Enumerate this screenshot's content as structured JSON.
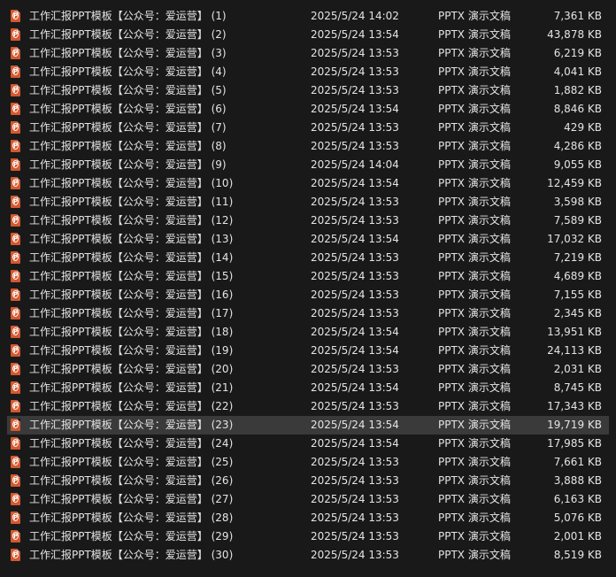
{
  "colors": {
    "background": "#191919",
    "selected_row": "#3a3a3a",
    "text": "#e4e4e4",
    "icon": "#d4582f"
  },
  "icon_name": "pptx-file-icon",
  "selected_index": 22,
  "files": [
    {
      "name": "工作汇报PPT模板【公众号：爱运营】 (1)",
      "date": "2025/5/24 14:02",
      "type": "PPTX 演示文稿",
      "size": "7,361 KB"
    },
    {
      "name": "工作汇报PPT模板【公众号：爱运营】 (2)",
      "date": "2025/5/24 13:54",
      "type": "PPTX 演示文稿",
      "size": "43,878 KB"
    },
    {
      "name": "工作汇报PPT模板【公众号：爱运营】 (3)",
      "date": "2025/5/24 13:53",
      "type": "PPTX 演示文稿",
      "size": "6,219 KB"
    },
    {
      "name": "工作汇报PPT模板【公众号：爱运营】 (4)",
      "date": "2025/5/24 13:53",
      "type": "PPTX 演示文稿",
      "size": "4,041 KB"
    },
    {
      "name": "工作汇报PPT模板【公众号：爱运营】 (5)",
      "date": "2025/5/24 13:53",
      "type": "PPTX 演示文稿",
      "size": "1,882 KB"
    },
    {
      "name": "工作汇报PPT模板【公众号：爱运营】 (6)",
      "date": "2025/5/24 13:54",
      "type": "PPTX 演示文稿",
      "size": "8,846 KB"
    },
    {
      "name": "工作汇报PPT模板【公众号：爱运营】 (7)",
      "date": "2025/5/24 13:53",
      "type": "PPTX 演示文稿",
      "size": "429 KB"
    },
    {
      "name": "工作汇报PPT模板【公众号：爱运营】 (8)",
      "date": "2025/5/24 13:53",
      "type": "PPTX 演示文稿",
      "size": "4,286 KB"
    },
    {
      "name": "工作汇报PPT模板【公众号：爱运营】 (9)",
      "date": "2025/5/24 14:04",
      "type": "PPTX 演示文稿",
      "size": "9,055 KB"
    },
    {
      "name": "工作汇报PPT模板【公众号：爱运营】 (10)",
      "date": "2025/5/24 13:54",
      "type": "PPTX 演示文稿",
      "size": "12,459 KB"
    },
    {
      "name": "工作汇报PPT模板【公众号：爱运营】 (11)",
      "date": "2025/5/24 13:53",
      "type": "PPTX 演示文稿",
      "size": "3,598 KB"
    },
    {
      "name": "工作汇报PPT模板【公众号：爱运营】 (12)",
      "date": "2025/5/24 13:53",
      "type": "PPTX 演示文稿",
      "size": "7,589 KB"
    },
    {
      "name": "工作汇报PPT模板【公众号：爱运营】 (13)",
      "date": "2025/5/24 13:54",
      "type": "PPTX 演示文稿",
      "size": "17,032 KB"
    },
    {
      "name": "工作汇报PPT模板【公众号：爱运营】 (14)",
      "date": "2025/5/24 13:53",
      "type": "PPTX 演示文稿",
      "size": "7,219 KB"
    },
    {
      "name": "工作汇报PPT模板【公众号：爱运营】 (15)",
      "date": "2025/5/24 13:53",
      "type": "PPTX 演示文稿",
      "size": "4,689 KB"
    },
    {
      "name": "工作汇报PPT模板【公众号：爱运营】 (16)",
      "date": "2025/5/24 13:53",
      "type": "PPTX 演示文稿",
      "size": "7,155 KB"
    },
    {
      "name": "工作汇报PPT模板【公众号：爱运营】 (17)",
      "date": "2025/5/24 13:53",
      "type": "PPTX 演示文稿",
      "size": "2,345 KB"
    },
    {
      "name": "工作汇报PPT模板【公众号：爱运营】 (18)",
      "date": "2025/5/24 13:54",
      "type": "PPTX 演示文稿",
      "size": "13,951 KB"
    },
    {
      "name": "工作汇报PPT模板【公众号：爱运营】 (19)",
      "date": "2025/5/24 13:54",
      "type": "PPTX 演示文稿",
      "size": "24,113 KB"
    },
    {
      "name": "工作汇报PPT模板【公众号：爱运营】 (20)",
      "date": "2025/5/24 13:53",
      "type": "PPTX 演示文稿",
      "size": "2,031 KB"
    },
    {
      "name": "工作汇报PPT模板【公众号：爱运营】 (21)",
      "date": "2025/5/24 13:54",
      "type": "PPTX 演示文稿",
      "size": "8,745 KB"
    },
    {
      "name": "工作汇报PPT模板【公众号：爱运营】 (22)",
      "date": "2025/5/24 13:53",
      "type": "PPTX 演示文稿",
      "size": "17,343 KB"
    },
    {
      "name": "工作汇报PPT模板【公众号：爱运营】 (23)",
      "date": "2025/5/24 13:54",
      "type": "PPTX 演示文稿",
      "size": "19,719 KB"
    },
    {
      "name": "工作汇报PPT模板【公众号：爱运营】 (24)",
      "date": "2025/5/24 13:54",
      "type": "PPTX 演示文稿",
      "size": "17,985 KB"
    },
    {
      "name": "工作汇报PPT模板【公众号：爱运营】 (25)",
      "date": "2025/5/24 13:53",
      "type": "PPTX 演示文稿",
      "size": "7,661 KB"
    },
    {
      "name": "工作汇报PPT模板【公众号：爱运营】 (26)",
      "date": "2025/5/24 13:53",
      "type": "PPTX 演示文稿",
      "size": "3,888 KB"
    },
    {
      "name": "工作汇报PPT模板【公众号：爱运营】 (27)",
      "date": "2025/5/24 13:53",
      "type": "PPTX 演示文稿",
      "size": "6,163 KB"
    },
    {
      "name": "工作汇报PPT模板【公众号：爱运营】 (28)",
      "date": "2025/5/24 13:53",
      "type": "PPTX 演示文稿",
      "size": "5,076 KB"
    },
    {
      "name": "工作汇报PPT模板【公众号：爱运营】 (29)",
      "date": "2025/5/24 13:53",
      "type": "PPTX 演示文稿",
      "size": "2,001 KB"
    },
    {
      "name": "工作汇报PPT模板【公众号：爱运营】 (30)",
      "date": "2025/5/24 13:53",
      "type": "PPTX 演示文稿",
      "size": "8,519 KB"
    }
  ]
}
